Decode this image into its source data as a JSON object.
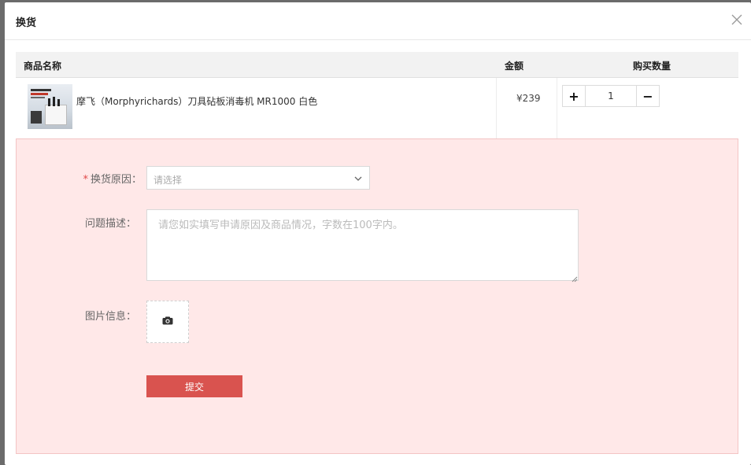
{
  "dialog": {
    "title": "换货",
    "close_icon": "close-icon"
  },
  "table": {
    "headers": {
      "name": "商品名称",
      "price": "金额",
      "quantity": "购买数量"
    },
    "rows": [
      {
        "name": "摩飞（Morphyrichards）刀具砧板消毒机 MR1000 白色",
        "price": "¥239",
        "quantity": "1",
        "thumbnail_icon": "product-image"
      }
    ],
    "stepper": {
      "plus": "+",
      "minus": "−"
    }
  },
  "form": {
    "reason": {
      "required_mark": "*",
      "label": "换货原因：",
      "placeholder": "请选择",
      "icon": "chevron-down-icon"
    },
    "description": {
      "label": "问题描述：",
      "placeholder": "请您如实填写申请原因及商品情况，字数在100字内。"
    },
    "images": {
      "label": "图片信息：",
      "icon": "camera-icon"
    },
    "submit_label": "提交"
  },
  "colors": {
    "panel_background": "#ffe8e8",
    "submit_button": "#d9534f",
    "required": "#e04848"
  }
}
